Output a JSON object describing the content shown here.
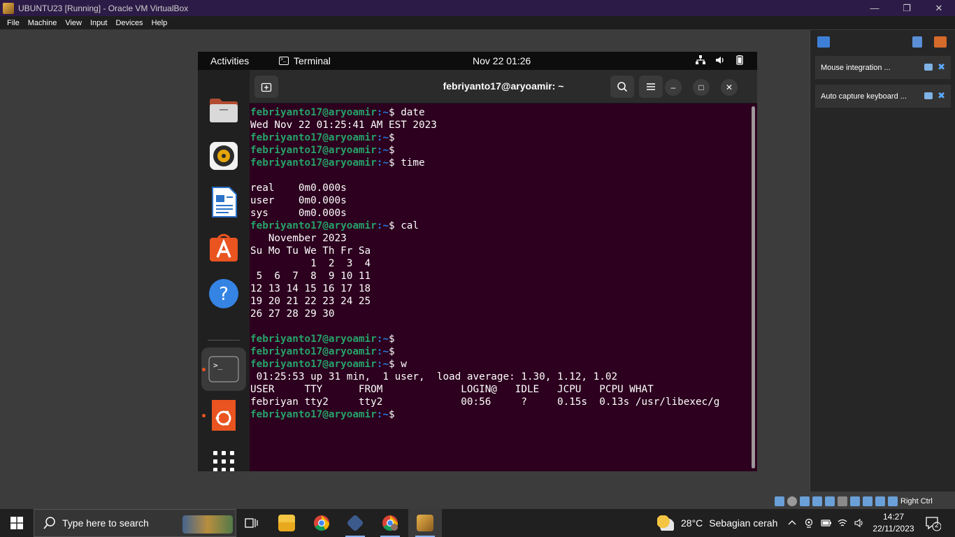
{
  "vbox": {
    "title": "UBUNTU23 [Running] - Oracle VM VirtualBox",
    "menu": [
      "File",
      "Machine",
      "View",
      "Input",
      "Devices",
      "Help"
    ],
    "host_key": "Right Ctrl"
  },
  "gnome": {
    "activities": "Activities",
    "app_name": "Terminal",
    "clock": "Nov 22  01:26"
  },
  "terminal": {
    "title": "febriyanto17@aryoamir: ~",
    "prompt_user": "febriyanto17@aryoamir",
    "prompt_path": ":~",
    "lines": [
      {
        "type": "prompt",
        "cmd": "date"
      },
      {
        "type": "out",
        "text": "Wed Nov 22 01:25:41 AM EST 2023"
      },
      {
        "type": "prompt",
        "cmd": ""
      },
      {
        "type": "prompt",
        "cmd": ""
      },
      {
        "type": "prompt",
        "cmd": "time"
      },
      {
        "type": "out",
        "text": ""
      },
      {
        "type": "out",
        "text": "real    0m0.000s"
      },
      {
        "type": "out",
        "text": "user    0m0.000s"
      },
      {
        "type": "out",
        "text": "sys     0m0.000s"
      },
      {
        "type": "prompt",
        "cmd": "cal"
      },
      {
        "type": "out",
        "text": "   November 2023"
      },
      {
        "type": "out",
        "text": "Su Mo Tu We Th Fr Sa"
      },
      {
        "type": "out",
        "text": "          1  2  3  4"
      },
      {
        "type": "out",
        "text": " 5  6  7  8  9 10 11"
      },
      {
        "type": "out",
        "text": "12 13 14 15 16 17 18"
      },
      {
        "type": "out",
        "text": "19 20 21 22 23 24 25"
      },
      {
        "type": "out",
        "text": "26 27 28 29 30"
      },
      {
        "type": "out",
        "text": ""
      },
      {
        "type": "prompt",
        "cmd": ""
      },
      {
        "type": "prompt",
        "cmd": ""
      },
      {
        "type": "prompt",
        "cmd": "w"
      },
      {
        "type": "out",
        "text": " 01:25:53 up 31 min,  1 user,  load average: 1.30, 1.12, 1.02"
      },
      {
        "type": "out",
        "text": "USER     TTY      FROM             LOGIN@   IDLE   JCPU   PCPU WHAT"
      },
      {
        "type": "out",
        "text": "febriyan tty2     tty2             00:56     ?     0.15s  0.13s /usr/libexec/g"
      },
      {
        "type": "prompt",
        "cmd": ""
      }
    ]
  },
  "side_panel": {
    "notices": [
      "Mouse integration ...",
      "Auto capture keyboard ..."
    ]
  },
  "taskbar": {
    "search_placeholder": "Type here to search",
    "weather_temp": "28°C",
    "weather_desc": "Sebagian cerah",
    "time": "14:27",
    "date": "22/11/2023",
    "notif_count": "2"
  },
  "colors": {
    "terminal_bg": "#2c001e",
    "prompt_user": "#26a269",
    "prompt_path": "#2a7bde"
  }
}
